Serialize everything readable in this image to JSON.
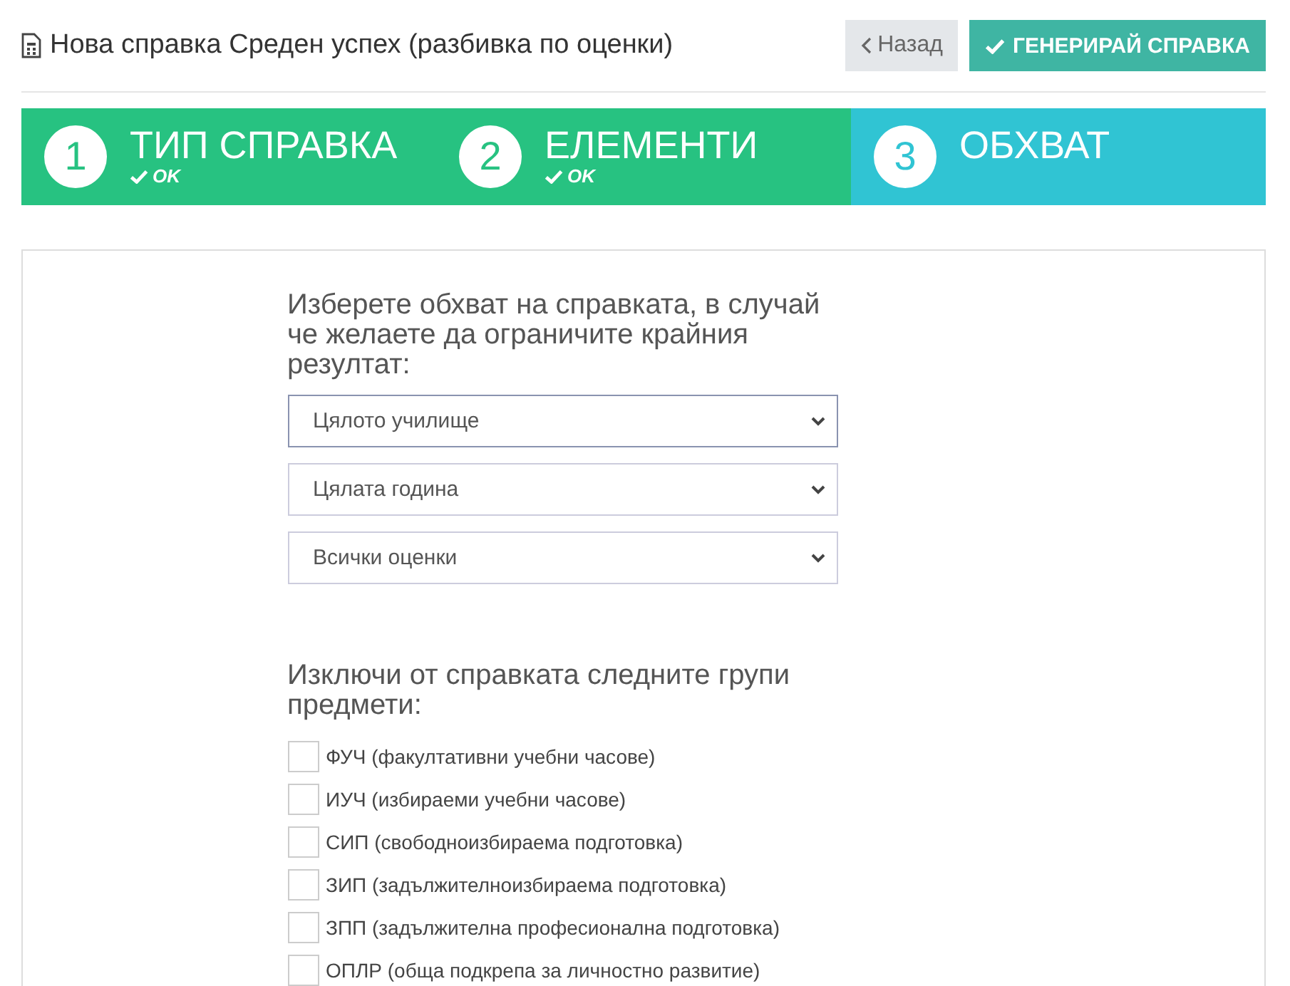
{
  "header": {
    "title": "Нова справка Среден успех (разбивка по оценки)",
    "back_button": "Назад",
    "generate_button": "ГЕНЕРИРАЙ СПРАВКА"
  },
  "steps": [
    {
      "number": "1",
      "label": "ТИП СПРАВКА",
      "done": true,
      "status": "OK"
    },
    {
      "number": "2",
      "label": "ЕЛЕМЕНТИ",
      "done": true,
      "status": "OK"
    },
    {
      "number": "3",
      "label": "ОБХВАТ",
      "done": false
    }
  ],
  "scope": {
    "prompt": "Изберете обхват на справката, в случай че желаете да ограничите крайния резултат:",
    "selects": [
      {
        "value": "Цялото училище",
        "focused": true
      },
      {
        "value": "Цялата година",
        "focused": false
      },
      {
        "value": "Всички оценки",
        "focused": false
      }
    ]
  },
  "exclude": {
    "prompt": "Изключи от справката следните групи предмети:",
    "options": [
      {
        "label": "ФУЧ (факултативни учебни часове)",
        "checked": false
      },
      {
        "label": "ИУЧ (избираеми учебни часове)",
        "checked": false
      },
      {
        "label": "СИП (свободноизбираема подготовка)",
        "checked": false
      },
      {
        "label": "ЗИП (задължителноизбираема подготовка)",
        "checked": false
      },
      {
        "label": "ЗПП (задължителна професионална подготовка)",
        "checked": false
      },
      {
        "label": "ОПЛР (обща подкрепа за личностно развитие)",
        "checked": false
      }
    ]
  }
}
